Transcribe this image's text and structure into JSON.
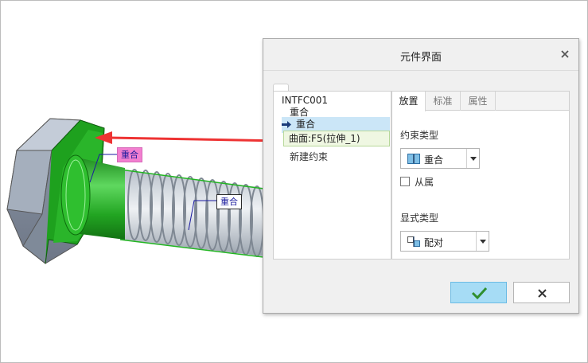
{
  "dialog": {
    "title": "元件界面",
    "close_glyph": "×"
  },
  "tree": {
    "root": "INTFC001",
    "items": [
      {
        "label": "重合"
      },
      {
        "label": "重合"
      },
      {
        "label": "曲面:F5(拉伸_1)"
      }
    ],
    "new_constraint": "新建约束"
  },
  "tabs": [
    {
      "label": "放置"
    },
    {
      "label": "标准"
    },
    {
      "label": "属性"
    }
  ],
  "placement": {
    "constraint_type_label": "约束类型",
    "constraint_type_value": "重合",
    "dependent_label": "从属",
    "dependent_checked": false,
    "display_type_label": "显式类型",
    "display_type_value": "配对"
  },
  "viewport": {
    "callouts": [
      {
        "label": "重合"
      },
      {
        "label": "重合"
      }
    ]
  },
  "colors": {
    "accent": "#a6dcf5",
    "selected_row": "#cbe6f7",
    "bolt_green": "#27b427",
    "arrow_red": "#ee3333"
  }
}
